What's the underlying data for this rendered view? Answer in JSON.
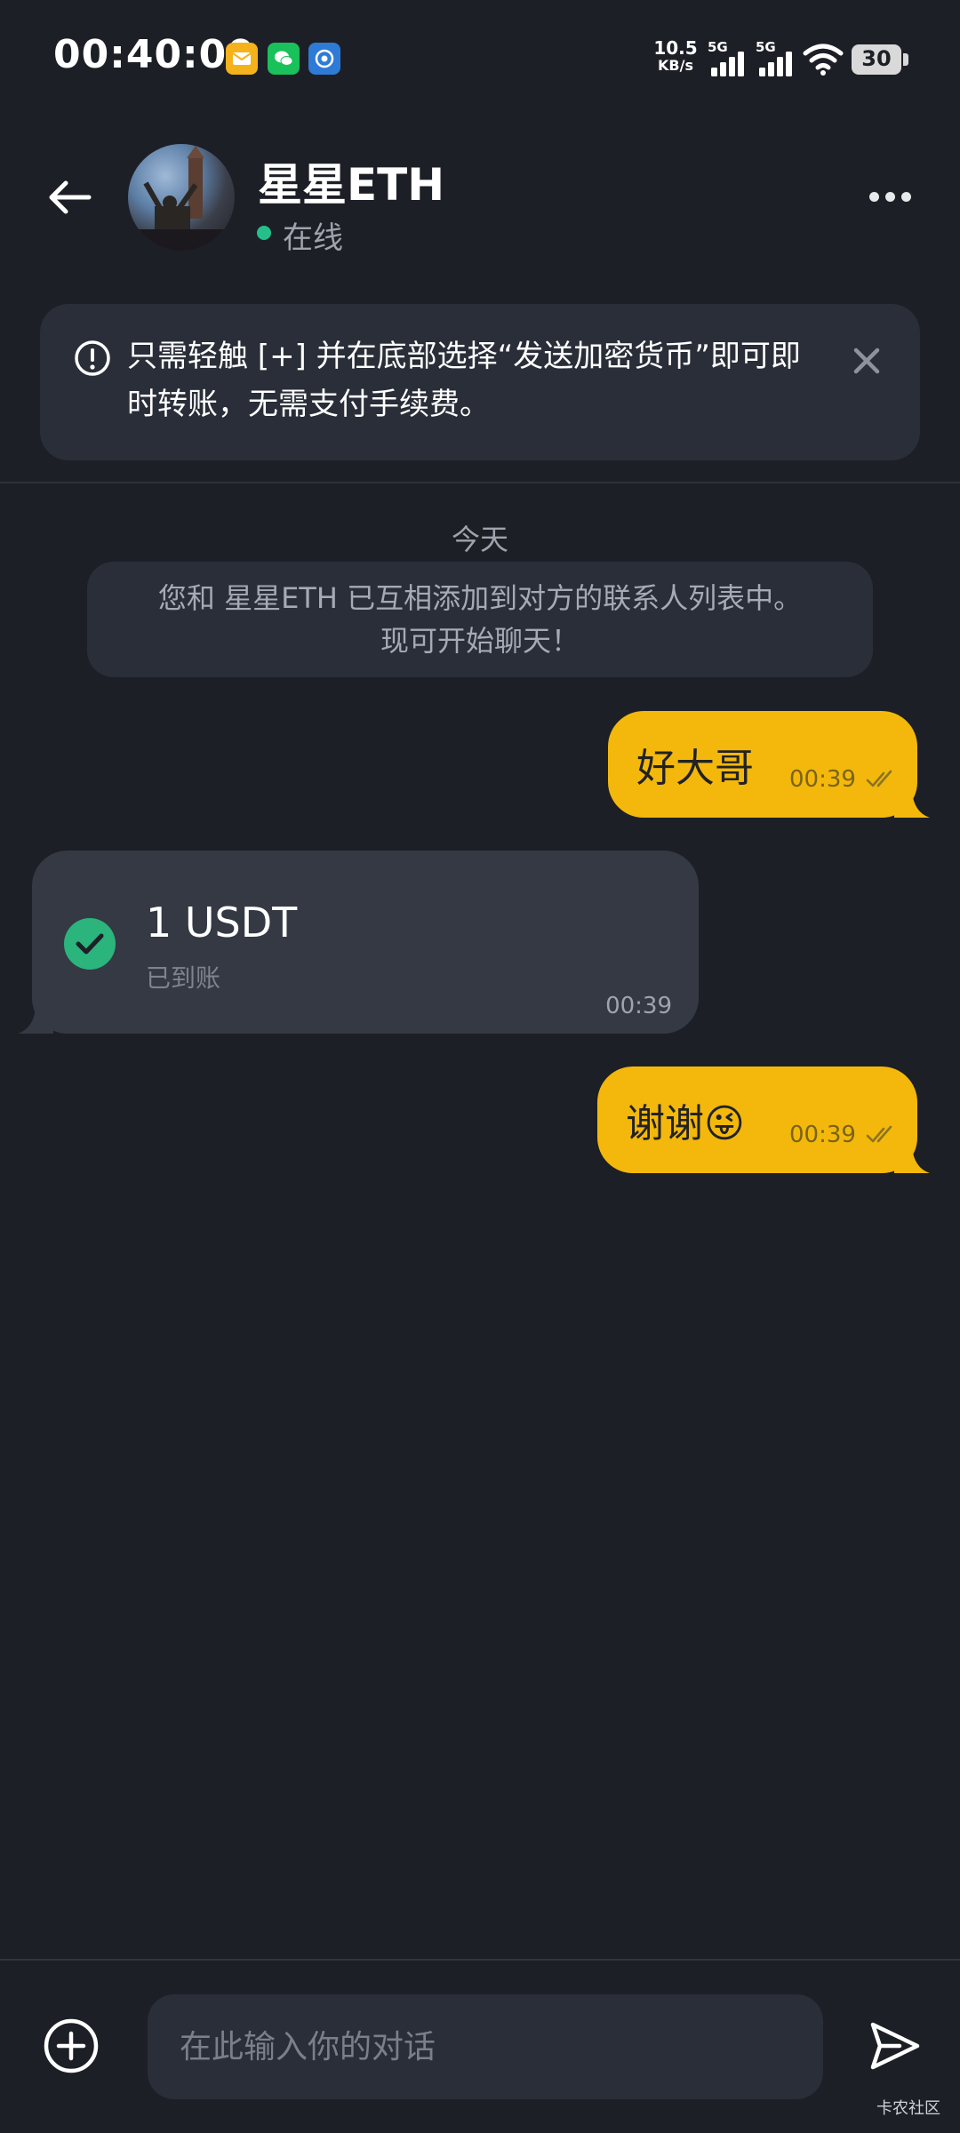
{
  "status_bar": {
    "time": "00:40:00",
    "net_speed_value": "10.5",
    "net_speed_unit": "KB/s",
    "sim1": "5G",
    "sim2": "5G",
    "battery": "30"
  },
  "header": {
    "contact_name": "星星ETH",
    "presence": "在线",
    "presence_color": "#25c08a"
  },
  "tip": {
    "text": "只需轻触 [+] 并在底部选择“发送加密货币”即可即时转账，无需支付手续费。"
  },
  "chat": {
    "day_label": "今天",
    "system_message_line1": "您和 星星ETH 已互相添加到对方的联系人列表中。",
    "system_message_line2": "现可开始聊天！",
    "messages": [
      {
        "direction": "out",
        "text": "好大哥",
        "time": "00:39",
        "status": "read"
      },
      {
        "direction": "in",
        "type": "payment",
        "amount": "1 USDT",
        "status_text": "已到账",
        "time": "00:39"
      },
      {
        "direction": "out",
        "text": "谢谢😜",
        "time": "00:39",
        "status": "read"
      }
    ]
  },
  "composer": {
    "placeholder": "在此输入你的对话"
  },
  "watermark": "卡农社区",
  "colors": {
    "background": "#1d1f26",
    "outgoing_bubble": "#f3b80b",
    "incoming_bubble": "#343944",
    "success": "#2bb47c"
  },
  "icons": [
    "mail-icon",
    "wechat-icon",
    "app-icon",
    "signal-icon",
    "wifi-icon",
    "battery-icon",
    "back-arrow-icon",
    "more-icon",
    "info-icon",
    "close-icon",
    "check-icon",
    "double-check-icon",
    "add-circle-icon",
    "send-icon"
  ]
}
